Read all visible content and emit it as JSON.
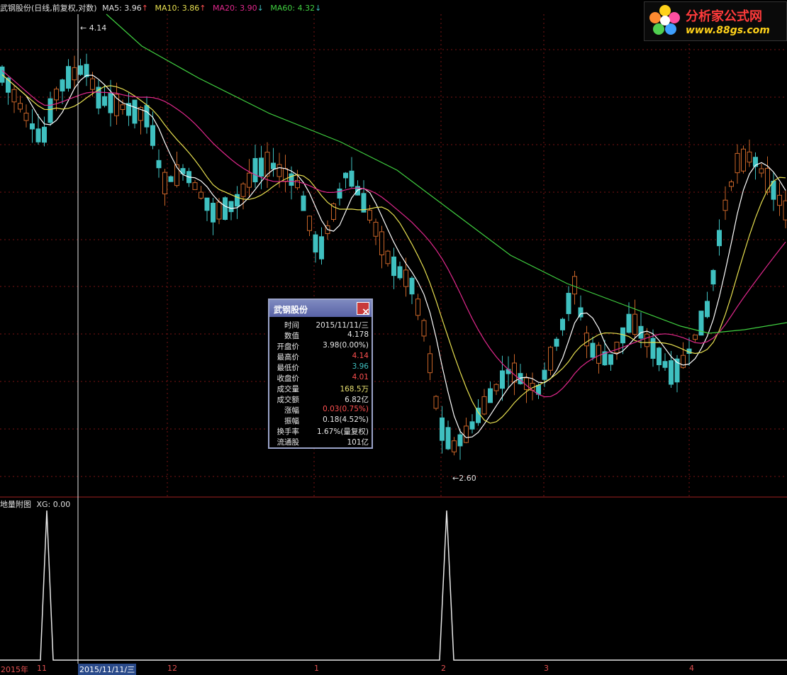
{
  "header": {
    "stock": "武钢股份(日线,前复权,对数)",
    "ma5": "MA5: 3.96",
    "ma10": "MA10: 3.86",
    "ma20": "MA20: 3.90",
    "ma60": "MA60: 4.32",
    "arrow_up": "↑",
    "arrow_down": "↓"
  },
  "logo": {
    "title": "分析家公式网",
    "url": "www.88gs.com"
  },
  "annotations": {
    "high": "4.14",
    "low": "2.60"
  },
  "sub_panel": {
    "title": "地量附图",
    "value": "XG: 0.00"
  },
  "popup": {
    "title": "武钢股份",
    "close": "×",
    "rows": [
      {
        "label": "时间",
        "value": "2015/11/11/三",
        "color": "#e8e8e8"
      },
      {
        "label": "数值",
        "value": "4.178",
        "color": "#e8e8e8"
      },
      {
        "label": "开盘价",
        "value": "3.98(0.00%)",
        "color": "#e8e8e8"
      },
      {
        "label": "最高价",
        "value": "4.14",
        "color": "#ff5050"
      },
      {
        "label": "最低价",
        "value": "3.96",
        "color": "#3fc0c0"
      },
      {
        "label": "收盘价",
        "value": "4.01",
        "color": "#ff5050"
      },
      {
        "label": "成交量",
        "value": "168.5万",
        "color": "#e8e070"
      },
      {
        "label": "成交额",
        "value": "6.82亿",
        "color": "#e8e8e8"
      },
      {
        "label": "涨幅",
        "value": "0.03(0.75%)",
        "color": "#ff5050"
      },
      {
        "label": "振幅",
        "value": "0.18(4.52%)",
        "color": "#e8e8e8"
      },
      {
        "label": "换手率",
        "value": "1.67%(量复权)",
        "color": "#e8e8e8"
      },
      {
        "label": "流通股",
        "value": "101亿",
        "color": "#e8e8e8"
      }
    ]
  },
  "axis": {
    "year": "2015年",
    "months": [
      "11",
      "12",
      "1",
      "2",
      "3",
      "4"
    ],
    "cursor_date": "2015/11/11/三"
  },
  "colors": {
    "up": "#c86428",
    "down": "#3fc0c0",
    "ma5": "#ffffff",
    "ma10": "#e8e050",
    "ma20": "#e0288c",
    "ma60": "#40d040",
    "grid": "#7a1414"
  },
  "chart_data": {
    "type": "candlestick",
    "price_range": [
      2.6,
      4.14
    ],
    "sub_indicator": {
      "name": "地量附图",
      "signals": 2
    }
  }
}
